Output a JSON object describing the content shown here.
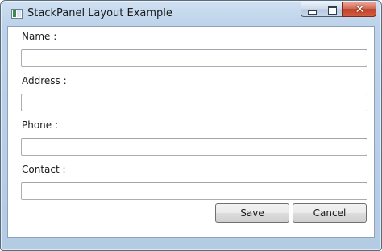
{
  "window": {
    "title": "StackPanel Layout Example",
    "icon": "app-window-icon",
    "controls": {
      "minimize": "minimize-icon",
      "maximize": "maximize-icon",
      "close": "close-icon",
      "close_glyph": "✕"
    }
  },
  "form": {
    "fields": [
      {
        "label": "Name :",
        "value": ""
      },
      {
        "label": "Address :",
        "value": ""
      },
      {
        "label": "Phone :",
        "value": ""
      },
      {
        "label": "Contact :",
        "value": ""
      }
    ],
    "buttons": {
      "save": "Save",
      "cancel": "Cancel"
    }
  },
  "colors": {
    "title_bar": "#bdd3ea",
    "close_button": "#c0422a",
    "window_border": "#5a6b7e"
  }
}
